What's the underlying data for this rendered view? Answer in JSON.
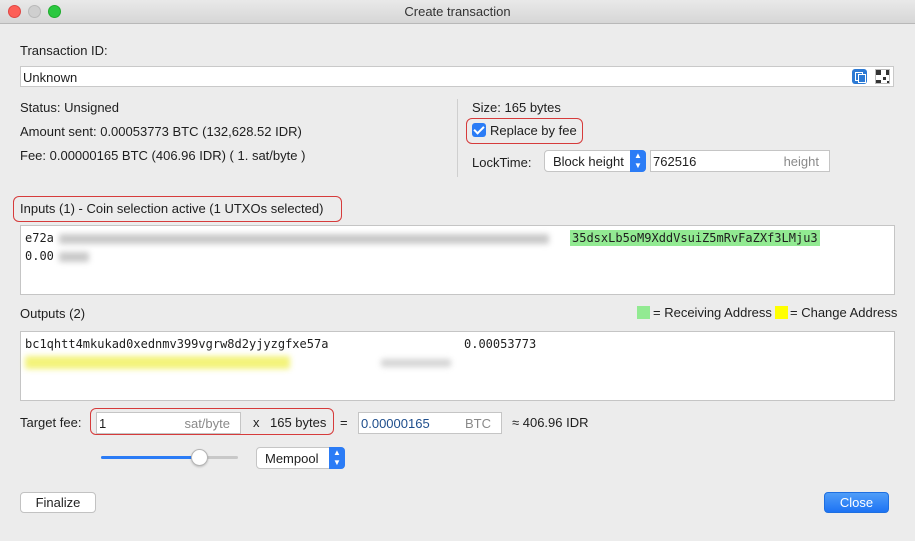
{
  "window": {
    "title": "Create transaction"
  },
  "txid": {
    "label": "Transaction ID:",
    "value": "Unknown"
  },
  "status": {
    "text": "Status: Unsigned"
  },
  "amount": {
    "text": "Amount sent: 0.00053773 BTC (132,628.52 IDR)"
  },
  "fee": {
    "text": "Fee: 0.00000165 BTC (406.96 IDR)  ( 1. sat/byte )"
  },
  "size": {
    "text": "Size: 165 bytes"
  },
  "rbf": {
    "label": "Replace by fee",
    "checked": true
  },
  "locktime": {
    "label": "LockTime:",
    "type_selected": "Block height",
    "value": "762516",
    "unit": "height"
  },
  "inputs": {
    "header": "Inputs (1)  -  Coin selection active (1 UTXOs selected)",
    "row_prefix": "e72a",
    "amount_prefix": "0.00",
    "address": "35dsxLb5oM9XddVsuiZ5mRvFaZXf3LMju3"
  },
  "outputs": {
    "header": "Outputs (2)",
    "legend_receiving": "= Receiving Address",
    "legend_change": "= Change Address",
    "receiving_color": "#92ea92",
    "change_color": "#ffff00",
    "row1_address": "bc1qhtt4mkukad0xednmv399vgrw8d2yjyzgfxe57a",
    "row1_amount": "0.00053773"
  },
  "target_fee": {
    "label": "Target fee:",
    "value": "1",
    "unit": "sat/byte",
    "times": "x",
    "bytes": "165 bytes",
    "equals": "=",
    "btc_value": "0.00000165",
    "btc_unit": "BTC",
    "fiat": "≈  406.96 IDR"
  },
  "slider": {
    "level": 0.7
  },
  "mempool": {
    "selected": "Mempool"
  },
  "buttons": {
    "finalize": "Finalize",
    "close": "Close"
  },
  "accent": "#2b7cf6"
}
